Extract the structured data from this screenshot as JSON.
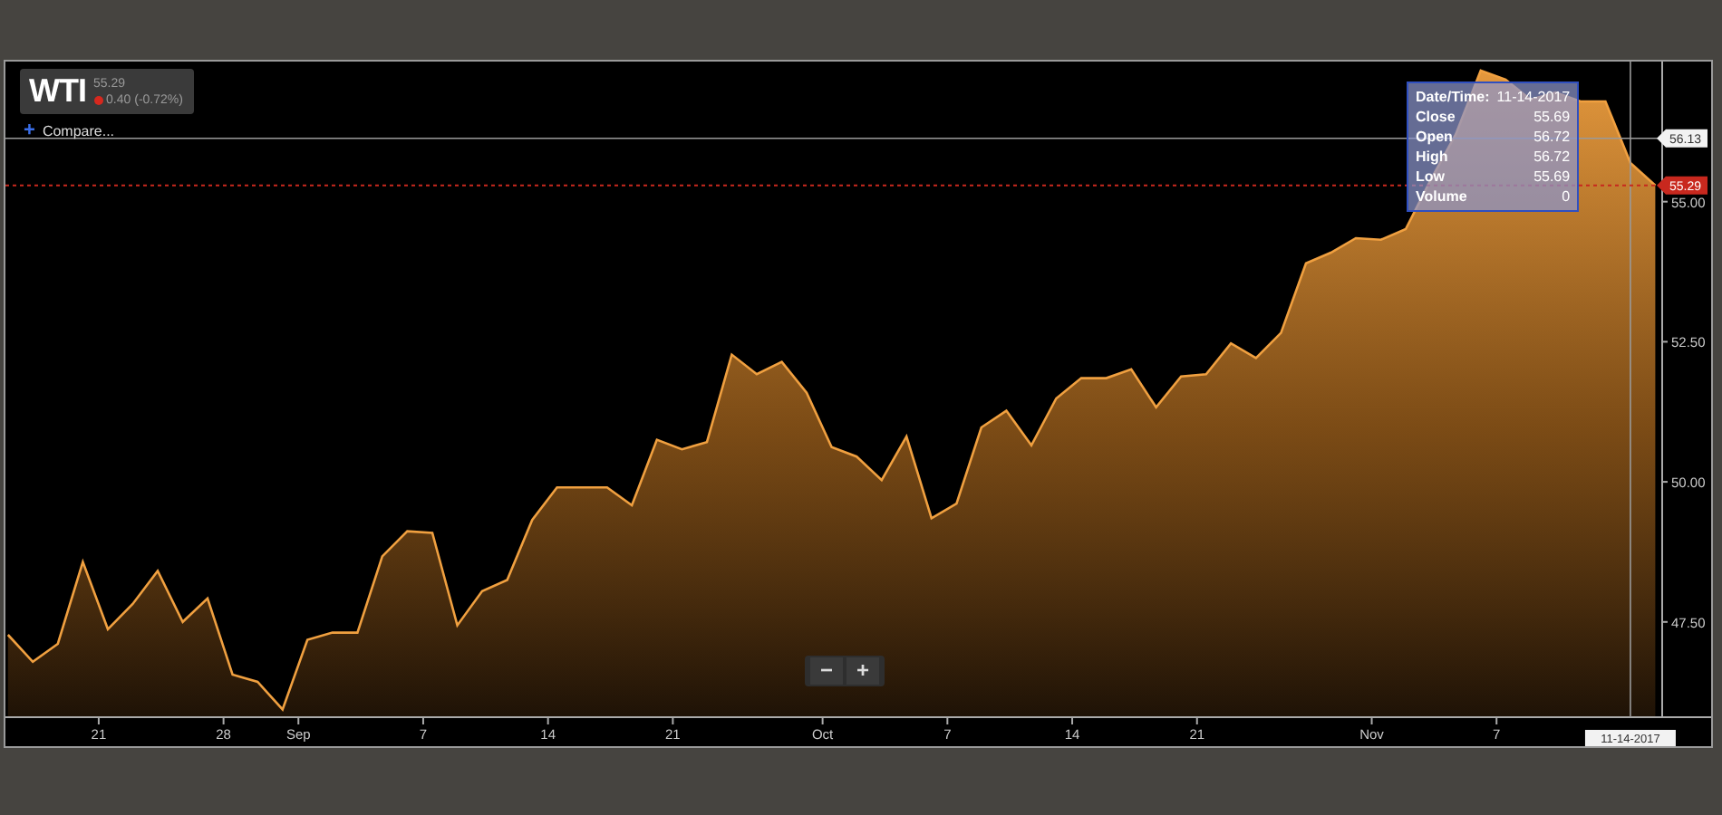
{
  "instrument": {
    "symbol": "WTI",
    "price": "55.29",
    "change": "0.40",
    "change_pct": "(-0.72%)",
    "negative": true
  },
  "compare": {
    "icon": "+",
    "label": "Compare..."
  },
  "tooltip": {
    "rows": [
      {
        "label": "Date/Time:",
        "value": "11-14-2017"
      },
      {
        "label": "Close",
        "value": "55.69"
      },
      {
        "label": "Open",
        "value": "56.72"
      },
      {
        "label": "High",
        "value": "56.72"
      },
      {
        "label": "Low",
        "value": "55.69"
      },
      {
        "label": "Volume",
        "value": "0"
      }
    ]
  },
  "zoom_controls": [
    "−",
    "+"
  ],
  "crosshair_date": "11-14-2017",
  "chart_data": {
    "type": "area",
    "categories": [
      null,
      null,
      null,
      null,
      "21",
      null,
      null,
      null,
      null,
      "28",
      null,
      null,
      "Sep",
      null,
      null,
      null,
      null,
      "7",
      null,
      null,
      null,
      null,
      "14",
      null,
      null,
      null,
      null,
      "21",
      null,
      null,
      null,
      null,
      null,
      "Oct",
      null,
      null,
      null,
      null,
      "7",
      null,
      null,
      null,
      null,
      "14",
      null,
      null,
      null,
      null,
      "21",
      null,
      null,
      null,
      null,
      null,
      null,
      "Nov",
      null,
      null,
      null,
      null,
      "7",
      null,
      null,
      null,
      null,
      null,
      null
    ],
    "ylim": [
      45.8,
      57.5
    ],
    "yticks": [
      {
        "value": 47.5,
        "label": "47.50"
      },
      {
        "value": 50,
        "label": "50.00"
      },
      {
        "value": 52.5,
        "label": "52.50"
      },
      {
        "value": 55,
        "label": "55.00"
      }
    ],
    "series": [
      {
        "color": "#f0a040",
        "values": [
          47.27,
          46.79,
          47.11,
          48.57,
          47.37,
          47.82,
          48.41,
          47.5,
          47.92,
          46.56,
          46.43,
          45.94,
          47.18,
          47.31,
          47.31,
          48.67,
          49.12,
          49.09,
          47.44,
          48.05,
          48.25,
          49.32,
          49.9,
          49.9,
          49.9,
          49.58,
          50.75,
          50.58,
          50.71,
          52.27,
          51.92,
          52.14,
          51.59,
          50.62,
          50.45,
          50.03,
          50.81,
          49.35,
          49.61,
          50.97,
          51.27,
          50.65,
          51.49,
          51.85,
          51.85,
          52.01,
          51.33,
          51.88,
          51.92,
          52.47,
          52.21,
          52.66,
          53.9,
          54.09,
          54.35,
          54.32,
          54.51,
          55.39,
          56.2,
          57.34,
          57.18,
          56.82,
          56.95,
          56.79,
          56.79,
          55.69,
          55.29
        ]
      }
    ],
    "ref_lines": [
      {
        "axis": "y",
        "value": 56.13,
        "label": "56.13",
        "color": "#9a9a9a"
      },
      {
        "axis": "y",
        "value": 55.29,
        "label": "55.29",
        "color": "#c8281e"
      }
    ]
  }
}
